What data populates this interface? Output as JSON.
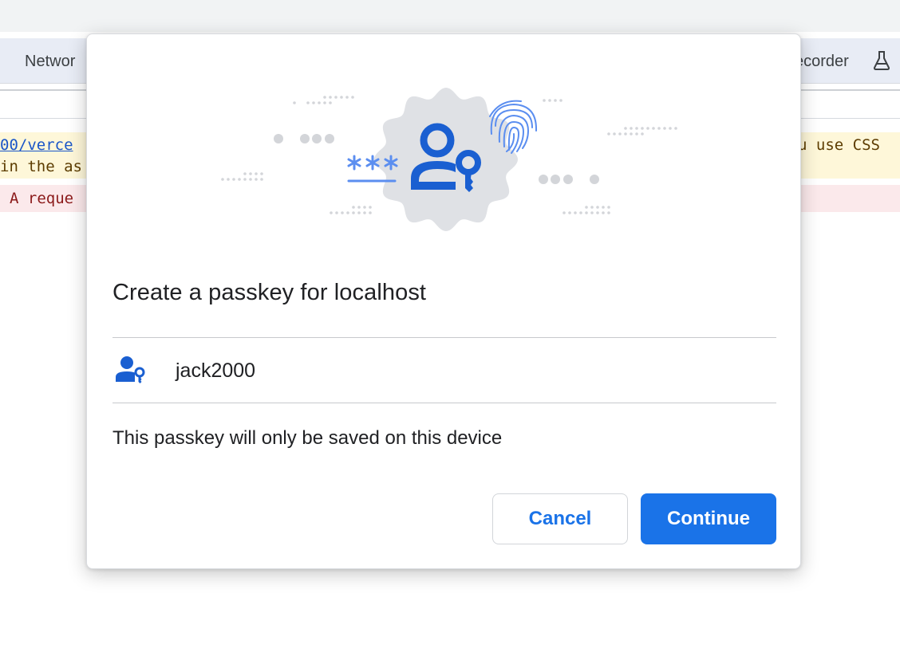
{
  "background": {
    "tabs": {
      "network_label": "Networ",
      "recorder_label": "ecorder",
      "flask_icon": "flask-icon"
    },
    "console": {
      "warning_line1_left": "00/verce",
      "warning_line1_right": "u use CSS",
      "warning_line2_left": "in the as",
      "error_line_left": "A reque"
    }
  },
  "dialog": {
    "title": "Create a passkey for localhost",
    "illustration": {
      "password_mask": "***",
      "icons": [
        "passkey-person-key-icon",
        "fingerprint-icon"
      ]
    },
    "account": {
      "icon": "passkey-person-key-icon",
      "username": "jack2000"
    },
    "info_text": "This passkey will only be saved on this device",
    "buttons": {
      "cancel_label": "Cancel",
      "continue_label": "Continue"
    }
  },
  "colors": {
    "primary": "#1a73e8",
    "icon_blue": "#1a5fd1",
    "badge_gray": "#dfe1e5",
    "dots_gray": "#d3d5d9"
  }
}
